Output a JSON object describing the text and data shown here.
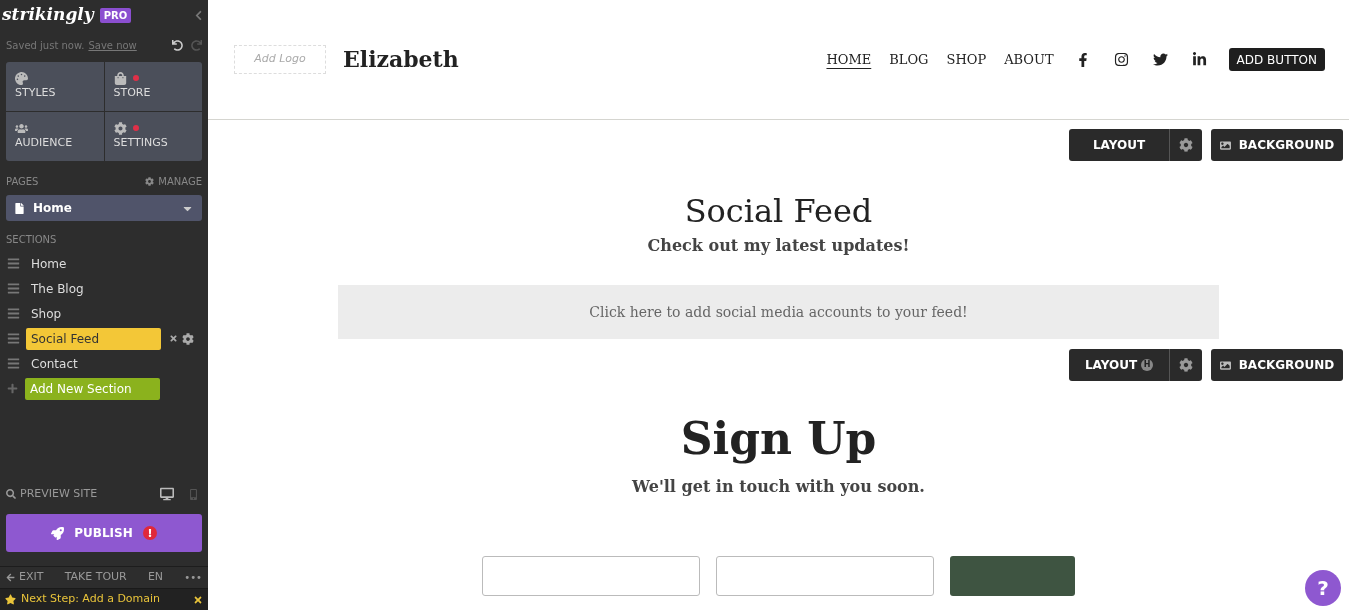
{
  "sidebar": {
    "logo": "strikingly",
    "badge": "PRO",
    "save_status": "Saved just now.",
    "save_link": "Save now",
    "tiles": [
      {
        "label": "STYLES",
        "kind": "styles",
        "alert": false
      },
      {
        "label": "STORE",
        "kind": "store",
        "alert": true
      },
      {
        "label": "AUDIENCE",
        "kind": "audience",
        "alert": false
      },
      {
        "label": "SETTINGS",
        "kind": "settings",
        "alert": true
      }
    ],
    "pages_label": "PAGES",
    "manage": "MANAGE",
    "page_select": "Home",
    "sections_label": "SECTIONS",
    "sections": [
      {
        "label": "Home",
        "selected": false
      },
      {
        "label": "The Blog",
        "selected": false
      },
      {
        "label": "Shop",
        "selected": false
      },
      {
        "label": "Social Feed",
        "selected": true
      },
      {
        "label": "Contact",
        "selected": false
      }
    ],
    "add_section": "Add New Section",
    "preview": "PREVIEW SITE",
    "publish": "PUBLISH",
    "footer": {
      "exit": "EXIT",
      "tour": "TAKE TOUR",
      "lang": "EN",
      "more": "•••"
    },
    "next_step": "Next Step: Add a Domain"
  },
  "site": {
    "add_logo": "Add Logo",
    "title": "Elizabeth",
    "nav": [
      {
        "label": "HOME",
        "selected": true
      },
      {
        "label": "BLOG",
        "selected": false
      },
      {
        "label": "SHOP",
        "selected": false
      },
      {
        "label": "ABOUT",
        "selected": false
      }
    ],
    "add_button": "ADD BUTTON",
    "toolbars": [
      {
        "layout": "LAYOUT",
        "background": "BACKGROUND"
      },
      {
        "layout": "LAYOUT",
        "badge": "H",
        "background": "BACKGROUND"
      }
    ],
    "social_feed": {
      "title": "Social Feed",
      "subtitle": "Check out my latest updates!",
      "cta": "Click here to add social media accounts to your feed!"
    },
    "signup": {
      "title": "Sign Up",
      "subtitle": "We'll get in touch with you soon."
    },
    "help": "?"
  }
}
